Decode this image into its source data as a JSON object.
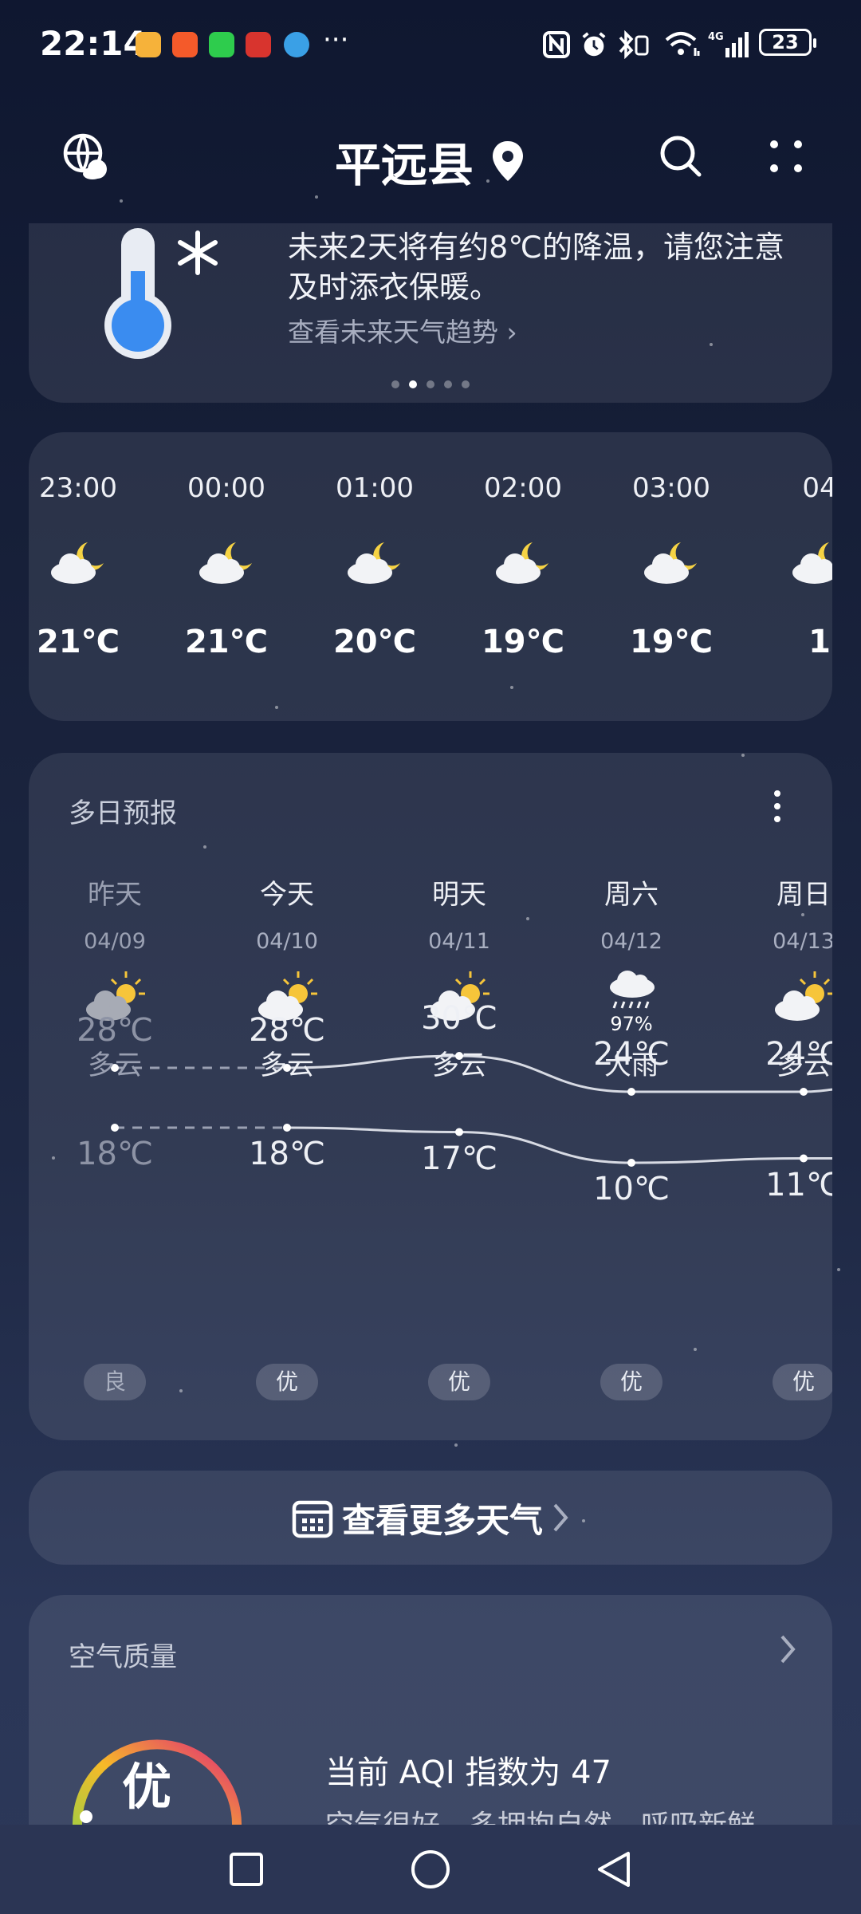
{
  "status_bar": {
    "time": "22:14",
    "more": "···",
    "battery": "23"
  },
  "header": {
    "city": "平远县"
  },
  "alert": {
    "text": "未来2天将有约8℃的降温，请您注意及时添衣保暖。",
    "link": "查看未来天气趋势 ›",
    "page_count": 5,
    "active_page": 1
  },
  "hourly": [
    {
      "time": "23:00",
      "icon": "moon-cloud-icon",
      "temp": "21℃"
    },
    {
      "time": "00:00",
      "icon": "moon-cloud-icon",
      "temp": "21℃"
    },
    {
      "time": "01:00",
      "icon": "moon-cloud-icon",
      "temp": "20℃"
    },
    {
      "time": "02:00",
      "icon": "moon-cloud-icon",
      "temp": "19℃"
    },
    {
      "time": "03:00",
      "icon": "moon-cloud-icon",
      "temp": "19℃"
    },
    {
      "time": "04",
      "icon": "moon-cloud-icon",
      "temp": "1"
    }
  ],
  "daily": {
    "title": "多日预报",
    "days": [
      {
        "name": "昨天",
        "date": "04/09",
        "icon": "sun-cloud-icon",
        "cond": "多云",
        "high": "28℃",
        "low": "18℃",
        "aqi": "良",
        "past": true
      },
      {
        "name": "今天",
        "date": "04/10",
        "icon": "sun-cloud-icon",
        "cond": "多云",
        "high": "28℃",
        "low": "18℃",
        "aqi": "优"
      },
      {
        "name": "明天",
        "date": "04/11",
        "icon": "sun-cloud-icon",
        "cond": "多云",
        "high": "30℃",
        "low": "17℃",
        "aqi": "优"
      },
      {
        "name": "周六",
        "date": "04/12",
        "icon": "heavy-rain-icon",
        "prob": "97%",
        "cond": "大雨",
        "high": "24℃",
        "low": "10℃",
        "aqi": "优"
      },
      {
        "name": "周日",
        "date": "04/13",
        "icon": "sun-cloud-icon",
        "cond": "多云",
        "high": "24℃",
        "low": "11℃",
        "aqi": "优"
      }
    ]
  },
  "more_weather": {
    "label": "查看更多天气"
  },
  "air": {
    "title": "空气质量",
    "level": "优",
    "main": "当前 AQI 指数为 47",
    "sub": "空气很好，多拥抱自然，呼吸新鲜"
  },
  "colors": {
    "gauge_start": "#8bd44a",
    "gauge_mid": "#f7b928",
    "gauge_end": "#e0287a"
  }
}
